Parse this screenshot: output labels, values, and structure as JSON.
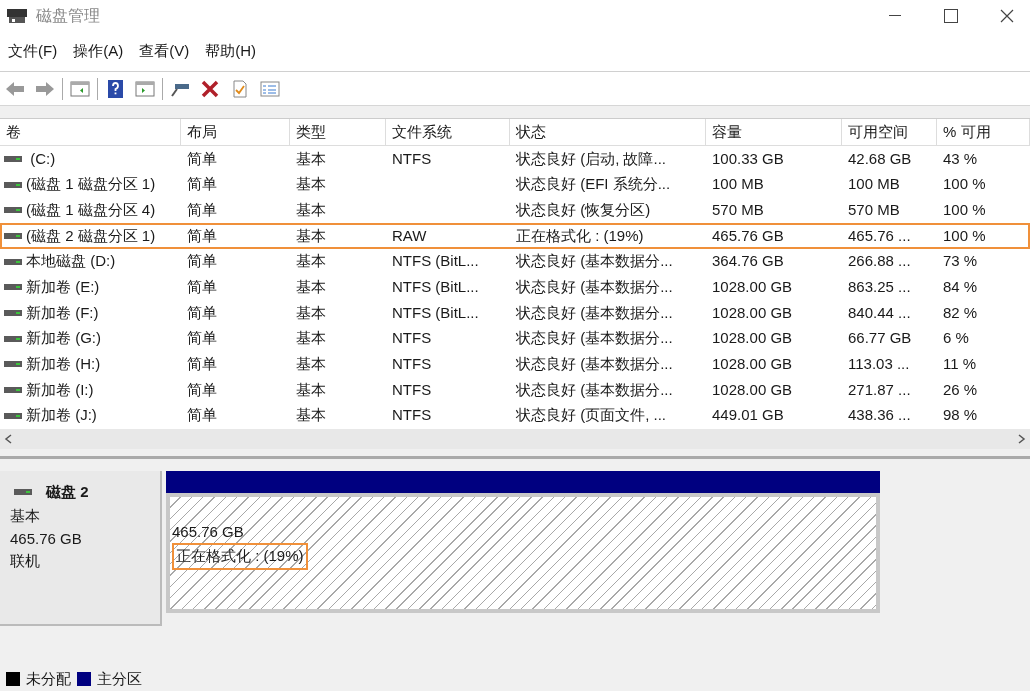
{
  "window": {
    "title": "磁盘管理"
  },
  "menu": [
    "文件(F)",
    "操作(A)",
    "查看(V)",
    "帮助(H)"
  ],
  "table": {
    "columns": [
      "卷",
      "布局",
      "类型",
      "文件系统",
      "状态",
      "容量",
      "可用空间",
      "% 可用"
    ],
    "rows": [
      {
        "cells": [
          " (C:)",
          "简单",
          "基本",
          "NTFS",
          "状态良好 (启动, 故障...",
          "100.33 GB",
          "42.68 GB",
          "43 %"
        ],
        "highlighted": false
      },
      {
        "cells": [
          "(磁盘 1 磁盘分区 1)",
          "简单",
          "基本",
          "",
          "状态良好 (EFI 系统分...",
          "100 MB",
          "100 MB",
          "100 %"
        ],
        "highlighted": false
      },
      {
        "cells": [
          "(磁盘 1 磁盘分区 4)",
          "简单",
          "基本",
          "",
          "状态良好 (恢复分区)",
          "570 MB",
          "570 MB",
          "100 %"
        ],
        "highlighted": false
      },
      {
        "cells": [
          "(磁盘 2 磁盘分区 1)",
          "简单",
          "基本",
          "RAW",
          "正在格式化 : (19%)",
          "465.76 GB",
          "465.76 ...",
          "100 %"
        ],
        "highlighted": true
      },
      {
        "cells": [
          "本地磁盘 (D:)",
          "简单",
          "基本",
          "NTFS (BitL...",
          "状态良好 (基本数据分...",
          "364.76 GB",
          "266.88 ...",
          "73 %"
        ],
        "highlighted": false
      },
      {
        "cells": [
          "新加卷 (E:)",
          "简单",
          "基本",
          "NTFS (BitL...",
          "状态良好 (基本数据分...",
          "1028.00 GB",
          "863.25 ...",
          "84 %"
        ],
        "highlighted": false
      },
      {
        "cells": [
          "新加卷 (F:)",
          "简单",
          "基本",
          "NTFS (BitL...",
          "状态良好 (基本数据分...",
          "1028.00 GB",
          "840.44 ...",
          "82 %"
        ],
        "highlighted": false
      },
      {
        "cells": [
          "新加卷 (G:)",
          "简单",
          "基本",
          "NTFS",
          "状态良好 (基本数据分...",
          "1028.00 GB",
          "66.77 GB",
          "6 %"
        ],
        "highlighted": false
      },
      {
        "cells": [
          "新加卷 (H:)",
          "简单",
          "基本",
          "NTFS",
          "状态良好 (基本数据分...",
          "1028.00 GB",
          "113.03 ...",
          "11 %"
        ],
        "highlighted": false
      },
      {
        "cells": [
          "新加卷 (I:)",
          "简单",
          "基本",
          "NTFS",
          "状态良好 (基本数据分...",
          "1028.00 GB",
          "271.87 ...",
          "26 %"
        ],
        "highlighted": false
      },
      {
        "cells": [
          "新加卷 (J:)",
          "简单",
          "基本",
          "NTFS",
          "状态良好 (页面文件, ...",
          "449.01 GB",
          "438.36 ...",
          "98 %"
        ],
        "highlighted": false
      }
    ]
  },
  "disk": {
    "name": "磁盘 2",
    "type": "基本",
    "size": "465.76 GB",
    "status": "联机",
    "partition": {
      "size": "465.76 GB",
      "status": "正在格式化 : (19%)",
      "highlighted": true
    }
  },
  "legend": [
    {
      "label": "未分配",
      "color": "#000000"
    },
    {
      "label": "主分区",
      "color": "#000080"
    }
  ]
}
